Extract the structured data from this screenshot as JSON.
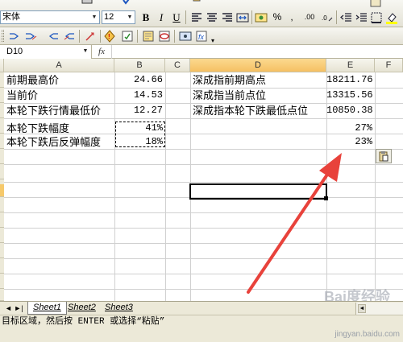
{
  "toolbar": {
    "font_name": "宋体",
    "font_size": "12",
    "bold_label": "B",
    "italic_label": "I",
    "underline_label": "U",
    "percent_label": "%",
    "comma_label": ",",
    "decimal_label": ".00"
  },
  "formula_bar": {
    "name_box": "D10",
    "fx_label": "fx",
    "formula": ""
  },
  "columns": [
    "A",
    "B",
    "C",
    "D",
    "E",
    "F"
  ],
  "cells": {
    "a1": "前期最高价",
    "b1": "24.66",
    "d1": "深成指前期高点",
    "e1": "18211.76",
    "a2": "当前价",
    "b2": "14.53",
    "d2": "深成指当前点位",
    "e2": "13315.56",
    "a3": "本轮下跌行情最低价",
    "b3": "12.27",
    "d3": "深成指本轮下跌最低点位",
    "e3": "10850.38",
    "a5": "本轮下跌幅度",
    "b5": "41%",
    "e5": "27%",
    "a6": "本轮下跌后反弹幅度",
    "b6": "18%",
    "e6": "23%"
  },
  "sheets": [
    "Sheet1",
    "Sheet2",
    "Sheet3"
  ],
  "tab_nav": "◄ ►|",
  "status_text": "目标区域，然后按 ENTER 或选择“粘贴”",
  "watermark_text": "jingyan.baidu.com",
  "watermark_logo": "Bai度经验",
  "colors": {
    "arrow": "#e8423b",
    "selected_header": "#f6c96b"
  }
}
